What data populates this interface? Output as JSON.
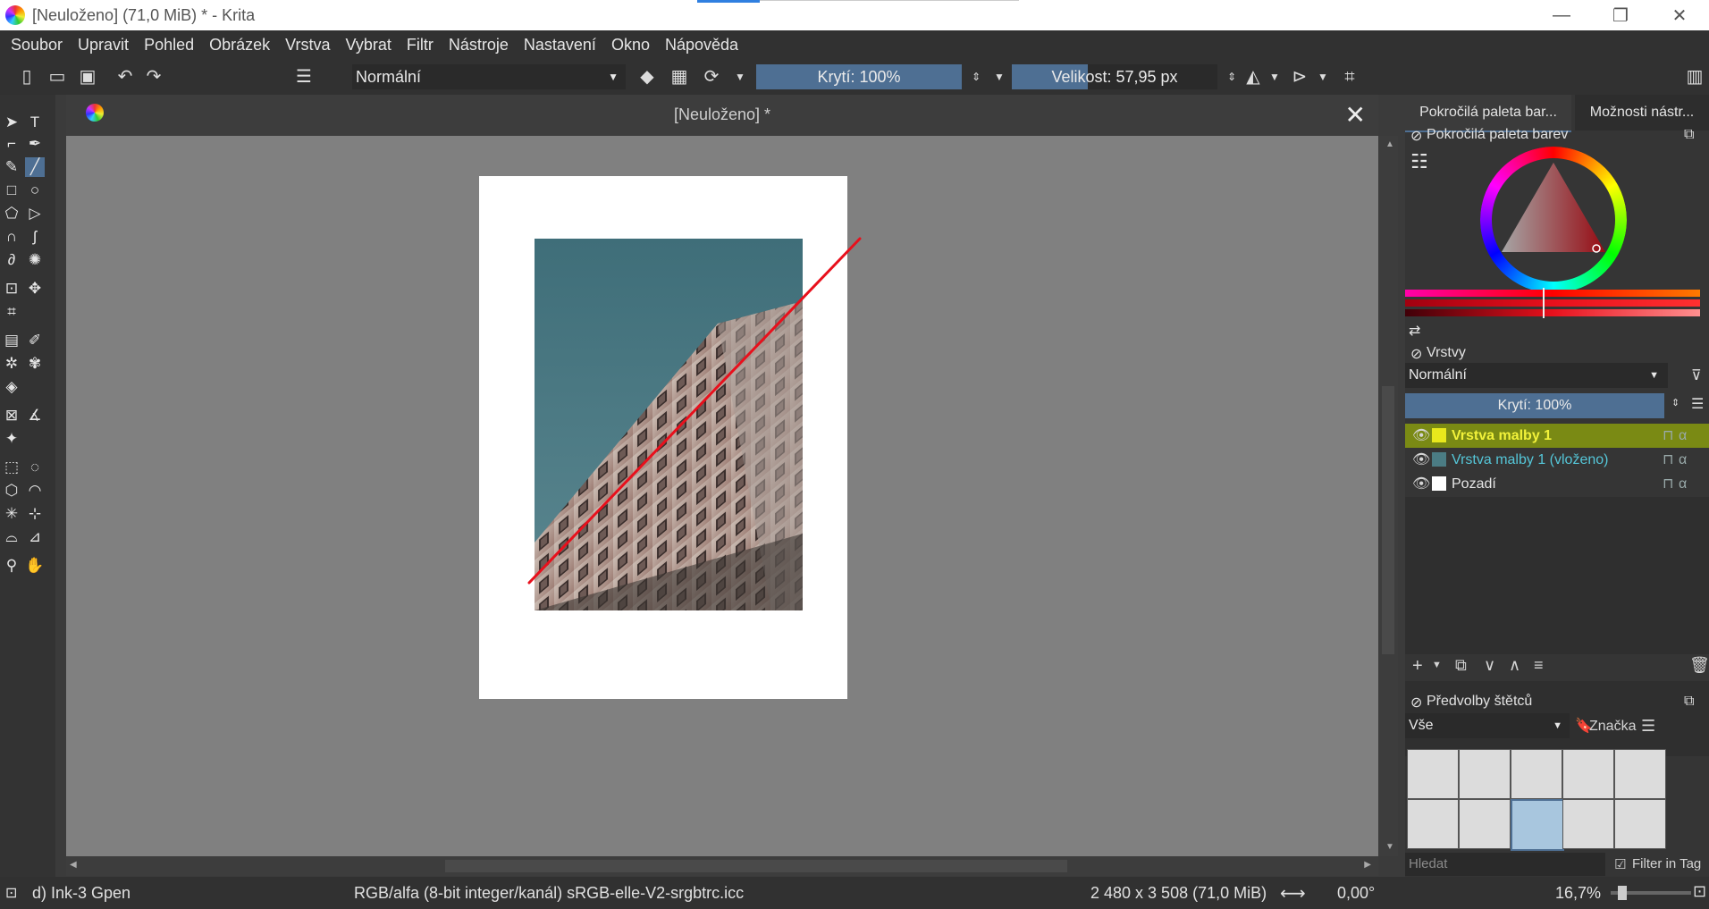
{
  "window": {
    "title": "[Neuloženo]  (71,0 MiB)  * - Krita",
    "minimize": "—",
    "maximize": "❐",
    "close": "✕"
  },
  "menu": [
    "Soubor",
    "Upravit",
    "Pohled",
    "Obrázek",
    "Vrstva",
    "Vybrat",
    "Filtr",
    "Nástroje",
    "Nastavení",
    "Okno",
    "Nápověda"
  ],
  "toolbar": {
    "blend_mode": "Normální",
    "opacity_label": "Krytí: 100%",
    "opacity_value": 1.0,
    "size_label": "Velikost: 57,95 px",
    "size_fill": 0.37,
    "colors": {
      "foreground": "#e8101c",
      "background": "#1a1a1a"
    }
  },
  "document": {
    "tab_title": "[Neuloženo]  *",
    "close": "✕"
  },
  "dock": {
    "tabs": [
      "Pokročilá paleta bar...",
      "Možnosti nástr..."
    ],
    "color_panel_title": "Pokročilá paleta barev",
    "layers_panel_title": "Vrstvy",
    "layers_blend": "Normální",
    "layers_opacity": "Krytí:  100%",
    "layers": [
      {
        "name": "Vrstva malby 1",
        "selected": true
      },
      {
        "name": "Vrstva malby 1 (vloženo)",
        "selected": false
      },
      {
        "name": "Pozadí",
        "selected": false
      }
    ],
    "brush_panel_title": "Předvolby štětců",
    "brush_filter": "Vše",
    "brush_tag": "Značka",
    "search_placeholder": "Hledat",
    "filter_in_tag": "Filter in Tag"
  },
  "status": {
    "brush": "d) Ink-3 Gpen",
    "color_profile": "RGB/alfa (8-bit integer/kanál)  sRGB-elle-V2-srgbtrc.icc",
    "image_size": "2 480 x 3 508 (71,0 MiB)",
    "rotation": "0,00°",
    "zoom": "16,7%"
  },
  "icons": {
    "new": "file-new-icon",
    "open": "folder-open-icon",
    "save": "save-icon",
    "undo": "undo-icon",
    "redo": "redo-icon",
    "eraser": "eraser-icon",
    "mirror_h": "mirror-horizontal-icon",
    "mirror_v": "mirror-vertical-icon",
    "wrap": "wrap-icon"
  }
}
